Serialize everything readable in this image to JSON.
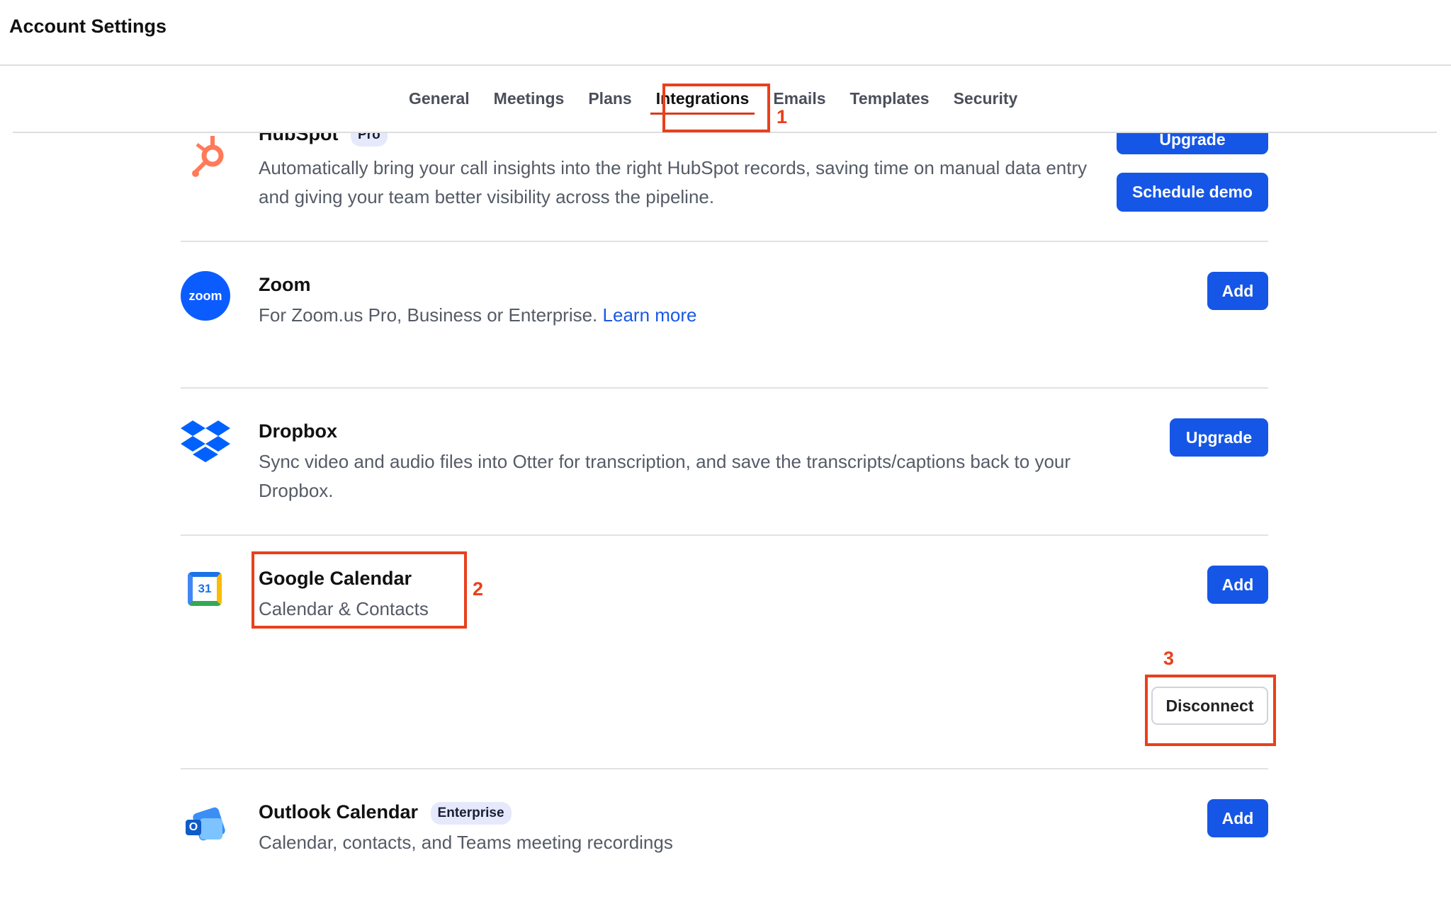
{
  "app": {
    "title": "Account Settings"
  },
  "tabs": [
    {
      "label": "General"
    },
    {
      "label": "Meetings"
    },
    {
      "label": "Plans"
    },
    {
      "label": "Integrations",
      "active": true
    },
    {
      "label": "Emails"
    },
    {
      "label": "Templates"
    },
    {
      "label": "Security"
    }
  ],
  "annotations": {
    "one": "1",
    "two": "2",
    "three": "3"
  },
  "integrations": {
    "hubspot": {
      "name": "HubSpot",
      "badge": "Pro",
      "description": "Automatically bring your call insights into the right HubSpot records, saving time on manual data entry and giving your team better visibility across the pipeline.",
      "upgrade_label": "Upgrade",
      "demo_label": "Schedule demo",
      "icon": "hubspot-logo"
    },
    "zoom": {
      "name": "Zoom",
      "description": "For Zoom.us Pro, Business or Enterprise.",
      "link_label": "Learn more",
      "logo_text": "zoom",
      "add_label": "Add",
      "icon": "zoom-logo"
    },
    "dropbox": {
      "name": "Dropbox",
      "description": "Sync video and audio files into Otter for transcription, and save the transcripts/captions back to your Dropbox.",
      "upgrade_label": "Upgrade",
      "icon": "dropbox-logo"
    },
    "google_calendar": {
      "name": "Google Calendar",
      "description": "Calendar & Contacts",
      "logo_text": "31",
      "add_label": "Add",
      "disconnect_label": "Disconnect",
      "icon": "google-calendar-logo"
    },
    "outlook_calendar": {
      "name": "Outlook Calendar",
      "badge": "Enterprise",
      "description": "Calendar, contacts, and Teams meeting recordings",
      "logo_text": "O",
      "add_label": "Add",
      "icon": "outlook-calendar-logo"
    }
  },
  "colors": {
    "accent": "#1656e6",
    "annotation": "#e8401c",
    "hubspot": "#ff7a59",
    "zoom": "#0b5cff",
    "dropbox": "#0061fe"
  }
}
